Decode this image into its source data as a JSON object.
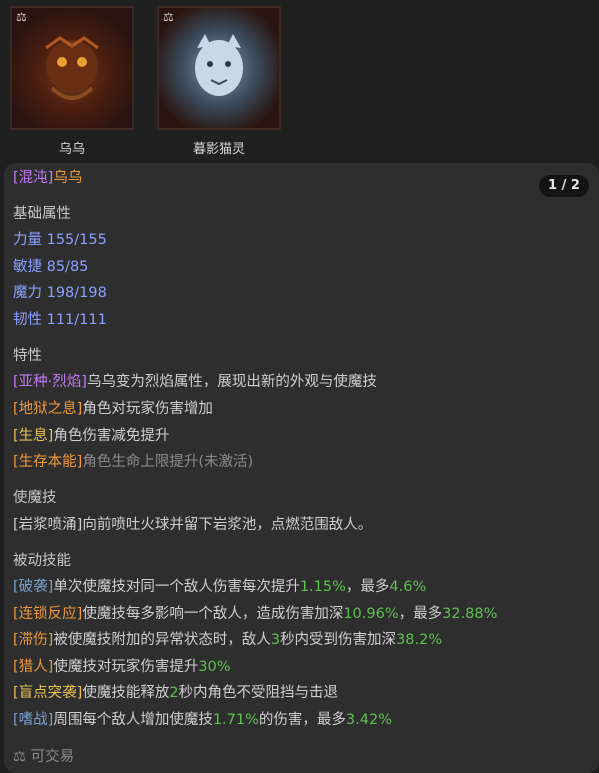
{
  "cards": [
    {
      "name": "乌乌",
      "icon": "scale-icon"
    },
    {
      "name": "暮影猫灵",
      "icon": "scale-icon"
    }
  ],
  "panel": {
    "pager": "1 / 2",
    "title_tag": "[混沌]",
    "title_name": "乌乌",
    "base_heading": "基础属性",
    "stats": [
      "力量 155/155",
      "敏捷 85/85",
      "魔力 198/198",
      "韧性 111/111"
    ],
    "traits_heading": "特性",
    "traits": [
      {
        "tag": "[亚种·烈焰]",
        "text": "乌乌变为烈焰属性，展现出新的外观与使魔技"
      },
      {
        "tag": "[地狱之息]",
        "text": "角色对玩家伤害增加"
      },
      {
        "tag": "[生息]",
        "text": "角色伤害减免提升"
      },
      {
        "tag": "[生存本能]",
        "text": "角色生命上限提升(未激活)"
      }
    ],
    "skill_heading": "使魔技",
    "skill_text": "[岩浆喷涌]向前喷吐火球并留下岩浆池，点燃范围敌人。",
    "passive_heading": "被动技能",
    "passives": [
      {
        "tag": "[破袭]",
        "parts": [
          "单次使魔技对同一个敌人伤害每次提升",
          "1.15%",
          "，最多",
          "4.6%"
        ]
      },
      {
        "tag": "[连锁反应]",
        "parts": [
          "使魔技每多影响一个敌人，造成伤害加深",
          "10.96%",
          "，最多",
          "32.88%"
        ]
      },
      {
        "tag": "[滞伤]",
        "parts": [
          "被使魔技附加的异常状态时，敌人",
          "3",
          "秒内受到伤害加深",
          "38.2%"
        ]
      },
      {
        "tag": "[猎人]",
        "parts": [
          "使魔技对玩家伤害提升",
          "30%"
        ]
      },
      {
        "tag": "[盲点突袭]",
        "parts": [
          "使魔技能释放",
          "2",
          "秒内角色不受阻挡与击退"
        ]
      },
      {
        "tag": "[嗜战]",
        "parts": [
          "周围每个敌人增加使魔技",
          "1.71%",
          "的伤害，最多",
          "3.42%"
        ]
      }
    ],
    "tradable": "可交易"
  }
}
